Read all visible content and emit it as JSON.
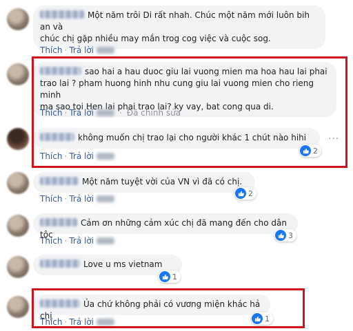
{
  "action_labels": {
    "like": "Thích",
    "reply": "Trả lời",
    "edited": "Đã chỉnh sửa"
  },
  "colors": {
    "bubble": "#f2f3f5",
    "link": "#385898",
    "highlight": "#d0121a",
    "like_blue": "#1877f2"
  },
  "comments": [
    {
      "text_line1": "Một năm trôi Di rất nhah. Chúc một năm mới luôn bih an và",
      "text_line2": "chúc chị gặp nhiều may mắn trog cog việc và cuộc sog."
    },
    {
      "text_line1": "sao hai a hau duoc giu lai vuong mien ma hoa hau lai phai",
      "text_line2": "trao lai ? pham huong hinh nhu cung giu lai vuong mien cho rieng minh",
      "text_line3": "ma sao toi Hen lai phai trao lai? ky vay, bat cong qua di."
    },
    {
      "text": "không muốn chị trao lại cho người khác 1 chút nào hihi",
      "reactions": "2"
    },
    {
      "text": "Một năm tuyệt vời của VN vì đã có chị.",
      "reactions": "2"
    },
    {
      "text": "Cảm ơn những cảm xúc chị đã mang đến cho dân tộc",
      "reactions": "3"
    },
    {
      "text": "Love u ms vietnam",
      "reactions": "1"
    },
    {
      "text": "Ủa chứ không phải có vương miện khác hả chị",
      "reactions": "1"
    }
  ]
}
